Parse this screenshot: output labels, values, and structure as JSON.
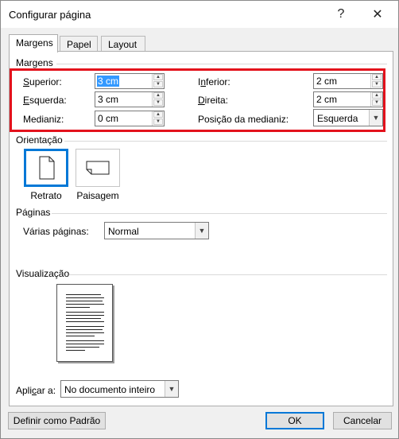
{
  "window": {
    "title": "Configurar página"
  },
  "titlebar": {
    "help_glyph": "?",
    "close_glyph": "✕"
  },
  "tabs": [
    {
      "label": "Margens",
      "active": true
    },
    {
      "label": "Papel",
      "active": false
    },
    {
      "label": "Layout",
      "active": false
    }
  ],
  "margins": {
    "section_title": "Margens",
    "superior": {
      "label": "Superior:",
      "value": "3 cm"
    },
    "inferior": {
      "label": "Inferior:",
      "value": "2 cm"
    },
    "esquerda": {
      "label": "Esquerda:",
      "value": "3 cm"
    },
    "direita": {
      "label": "Direita:",
      "value": "2 cm"
    },
    "medianiz": {
      "label": "Medianiz:",
      "value": "0 cm"
    },
    "posicao_medianiz": {
      "label": "Posição da medianiz:",
      "value": "Esquerda"
    },
    "highlight_color": "#e3121c"
  },
  "orientation": {
    "section_title": "Orientação",
    "portrait_label": "Retrato",
    "landscape_label": "Paisagem",
    "selected": "portrait"
  },
  "pages": {
    "section_title": "Páginas",
    "multiple_pages_label": "Várias páginas:",
    "multiple_pages_value": "Normal"
  },
  "preview": {
    "section_title": "Visualização"
  },
  "apply_to": {
    "label": "Aplicar a:",
    "value": "No documento inteiro"
  },
  "footer": {
    "set_default_label": "Definir como Padrão",
    "ok_label": "OK",
    "cancel_label": "Cancelar"
  },
  "accent_color": "#0078d7"
}
